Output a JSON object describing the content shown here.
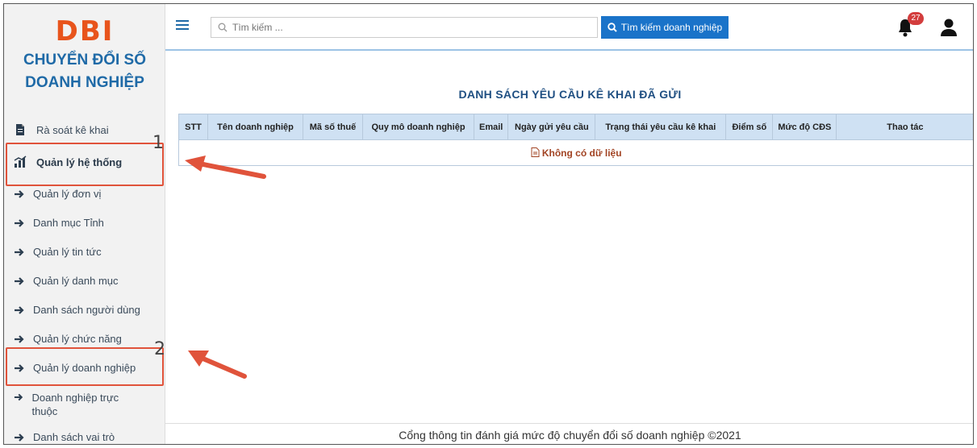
{
  "sidebar": {
    "logo": "DBI",
    "subtitle_line1": "CHUYỂN ĐỔI SỐ",
    "subtitle_line2": "DOANH NGHIỆP",
    "items": [
      {
        "label": "Rà soát kê khai"
      },
      {
        "label": "Quản lý hệ thống"
      },
      {
        "label": "Quản lý đơn vị"
      },
      {
        "label": "Danh mục Tỉnh"
      },
      {
        "label": "Quản lý tin tức"
      },
      {
        "label": "Quản lý danh mục"
      },
      {
        "label": "Danh sách người dùng"
      },
      {
        "label": "Quản lý chức năng"
      },
      {
        "label": "Quản lý doanh nghiệp"
      },
      {
        "label": "Doanh nghiệp trực thuộc"
      },
      {
        "label": "Danh sách vai trò"
      }
    ],
    "callout_1": "1",
    "callout_2": "2"
  },
  "header": {
    "search_placeholder": "Tìm kiếm ...",
    "search_button": "Tìm kiếm doanh nghiệp",
    "notification_count": "27"
  },
  "main": {
    "title": "DANH SÁCH YÊU CẦU KÊ KHAI ĐÃ GỬI",
    "columns": [
      "STT",
      "Tên doanh nghiệp",
      "Mã số thuế",
      "Quy mô doanh nghiệp",
      "Email",
      "Ngày gửi yêu cầu",
      "Trạng thái yêu cầu kê khai",
      "Điểm số",
      "Mức độ CĐS",
      "Thao tác"
    ],
    "empty_text": "Không có dữ liệu"
  },
  "footer": {
    "text": "Cổng thông tin đánh giá mức độ chuyển đổi số doanh nghiệp ©2021"
  },
  "colors": {
    "accent": "#1a73c9",
    "brand": "#e8541c",
    "highlight": "#e0533b",
    "header_row": "#cfe1f3"
  }
}
